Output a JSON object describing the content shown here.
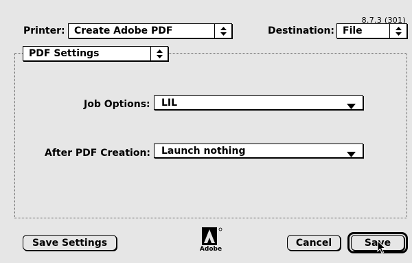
{
  "version": "8.7.3 (301)",
  "printer": {
    "label": "Printer:",
    "value": "Create Adobe PDF"
  },
  "destination": {
    "label": "Destination:",
    "value": "File"
  },
  "panel": {
    "value": "PDF Settings"
  },
  "job_options": {
    "label": "Job Options:",
    "value": "LIL"
  },
  "after_creation": {
    "label": "After PDF Creation:",
    "value": "Launch nothing"
  },
  "buttons": {
    "save_settings": "Save Settings",
    "cancel": "Cancel",
    "save": "Save"
  },
  "logo": {
    "word": "Adobe"
  },
  "icons": {
    "popup_arrows": "up-down-arrows-icon",
    "dropdown": "triangle-down-icon",
    "cursor": "arrow-cursor-icon"
  }
}
